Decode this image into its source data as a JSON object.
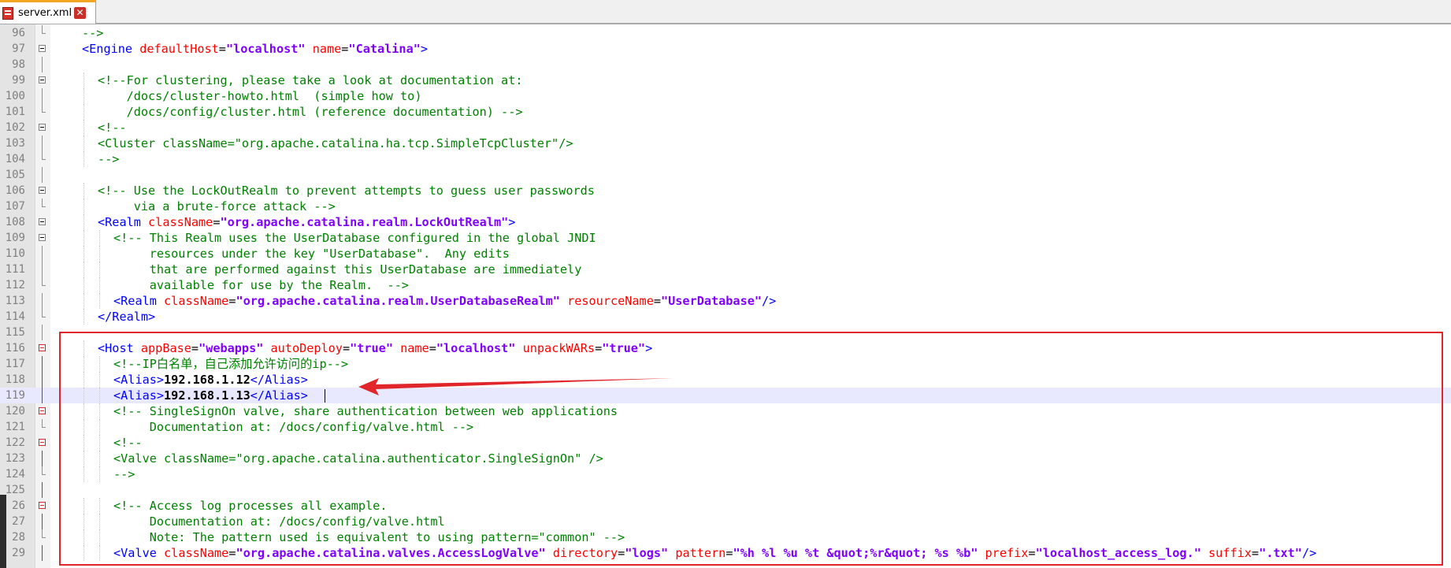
{
  "tab": {
    "filename": "server.xml",
    "close_glyph": "✕"
  },
  "colors": {
    "tag": "#0000ff",
    "attribute": "#ff0000",
    "value": "#8000ff",
    "comment": "#008000",
    "highlight_box": "#e0262a",
    "current_line": "#e8e8ff"
  },
  "lines": [
    {
      "n": "96",
      "fold": "end",
      "seg": [
        [
          "cmt",
          "-->"
        ]
      ]
    },
    {
      "n": "97",
      "fold": "open",
      "indent": 1,
      "seg": [
        [
          "bracket",
          "<"
        ],
        [
          "tag",
          "Engine"
        ],
        [
          "sp",
          " "
        ],
        [
          "attr",
          "defaultHost"
        ],
        [
          "eq",
          "="
        ],
        [
          "val",
          "\"localhost\""
        ],
        [
          "sp",
          " "
        ],
        [
          "attr",
          "name"
        ],
        [
          "eq",
          "="
        ],
        [
          "val",
          "\"Catalina\""
        ],
        [
          "bracket",
          ">"
        ]
      ]
    },
    {
      "n": "98",
      "fold": "line",
      "seg": []
    },
    {
      "n": "99",
      "fold": "open",
      "indent": 2,
      "seg": [
        [
          "cmt",
          "<!--For clustering, please take a look at documentation at:"
        ]
      ]
    },
    {
      "n": "100",
      "fold": "line",
      "indent": 2,
      "seg": [
        [
          "cmt",
          "    /docs/cluster-howto.html  (simple how to)"
        ]
      ]
    },
    {
      "n": "101",
      "fold": "end",
      "indent": 2,
      "seg": [
        [
          "cmt",
          "    /docs/config/cluster.html (reference documentation) -->"
        ]
      ]
    },
    {
      "n": "102",
      "fold": "open",
      "indent": 2,
      "seg": [
        [
          "cmt",
          "<!--"
        ]
      ]
    },
    {
      "n": "103",
      "fold": "line",
      "indent": 2,
      "seg": [
        [
          "cmt",
          "<Cluster className=\"org.apache.catalina.ha.tcp.SimpleTcpCluster\"/>"
        ]
      ]
    },
    {
      "n": "104",
      "fold": "end",
      "indent": 2,
      "seg": [
        [
          "cmt",
          "-->"
        ]
      ]
    },
    {
      "n": "105",
      "fold": "line",
      "seg": []
    },
    {
      "n": "106",
      "fold": "open",
      "indent": 2,
      "seg": [
        [
          "cmt",
          "<!-- Use the LockOutRealm to prevent attempts to guess user passwords"
        ]
      ]
    },
    {
      "n": "107",
      "fold": "end",
      "indent": 2,
      "seg": [
        [
          "cmt",
          "     via a brute-force attack -->"
        ]
      ]
    },
    {
      "n": "108",
      "fold": "open",
      "indent": 2,
      "seg": [
        [
          "bracket",
          "<"
        ],
        [
          "tag",
          "Realm"
        ],
        [
          "sp",
          " "
        ],
        [
          "attr",
          "className"
        ],
        [
          "eq",
          "="
        ],
        [
          "val",
          "\"org.apache.catalina.realm.LockOutRealm\""
        ],
        [
          "bracket",
          ">"
        ]
      ]
    },
    {
      "n": "109",
      "fold": "open",
      "indent": 3,
      "seg": [
        [
          "cmt",
          "<!-- This Realm uses the UserDatabase configured in the global JNDI"
        ]
      ]
    },
    {
      "n": "110",
      "fold": "line",
      "indent": 3,
      "seg": [
        [
          "cmt",
          "     resources under the key \"UserDatabase\".  Any edits"
        ]
      ]
    },
    {
      "n": "111",
      "fold": "line",
      "indent": 3,
      "seg": [
        [
          "cmt",
          "     that are performed against this UserDatabase are immediately"
        ]
      ]
    },
    {
      "n": "112",
      "fold": "end",
      "indent": 3,
      "seg": [
        [
          "cmt",
          "     available for use by the Realm.  -->"
        ]
      ]
    },
    {
      "n": "113",
      "fold": "line",
      "indent": 3,
      "seg": [
        [
          "bracket",
          "<"
        ],
        [
          "tag",
          "Realm"
        ],
        [
          "sp",
          " "
        ],
        [
          "attr",
          "className"
        ],
        [
          "eq",
          "="
        ],
        [
          "val",
          "\"org.apache.catalina.realm.UserDatabaseRealm\""
        ],
        [
          "sp",
          " "
        ],
        [
          "attr",
          "resourceName"
        ],
        [
          "eq",
          "="
        ],
        [
          "val",
          "\"UserDatabase\""
        ],
        [
          "bracket",
          "/>"
        ]
      ]
    },
    {
      "n": "114",
      "fold": "end",
      "indent": 2,
      "seg": [
        [
          "bracket",
          "</"
        ],
        [
          "tag",
          "Realm"
        ],
        [
          "bracket",
          ">"
        ]
      ]
    },
    {
      "n": "115",
      "fold": "line",
      "seg": []
    },
    {
      "n": "116",
      "fold": "open-red",
      "indent": 2,
      "seg": [
        [
          "bracket",
          "<"
        ],
        [
          "tag",
          "Host"
        ],
        [
          "sp",
          " "
        ],
        [
          "attr",
          "appBase"
        ],
        [
          "eq",
          "="
        ],
        [
          "val",
          "\"webapps\""
        ],
        [
          "sp",
          " "
        ],
        [
          "attr",
          "autoDeploy"
        ],
        [
          "eq",
          "="
        ],
        [
          "val",
          "\"true\""
        ],
        [
          "sp",
          " "
        ],
        [
          "attr",
          "name"
        ],
        [
          "eq",
          "="
        ],
        [
          "val",
          "\"localhost\""
        ],
        [
          "sp",
          " "
        ],
        [
          "attr",
          "unpackWARs"
        ],
        [
          "eq",
          "="
        ],
        [
          "val",
          "\"true\""
        ],
        [
          "bracket",
          ">"
        ]
      ]
    },
    {
      "n": "117",
      "fold": "line-red",
      "indent": 3,
      "seg": [
        [
          "cmt",
          "<!--IP白名单，自己添加允许访问的ip-->"
        ]
      ]
    },
    {
      "n": "118",
      "fold": "line-red",
      "indent": 3,
      "seg": [
        [
          "bracket",
          "<"
        ],
        [
          "tag",
          "Alias"
        ],
        [
          "bracket",
          ">"
        ],
        [
          "text",
          "192.168.1.12"
        ],
        [
          "bracket",
          "</"
        ],
        [
          "tag",
          "Alias"
        ],
        [
          "bracket",
          ">"
        ]
      ]
    },
    {
      "n": "119",
      "fold": "line-red",
      "indent": 3,
      "current": true,
      "seg": [
        [
          "bracket",
          "<"
        ],
        [
          "tag",
          "Alias"
        ],
        [
          "bracket",
          ">"
        ],
        [
          "text",
          "192.168.1.13"
        ],
        [
          "bracket",
          "</"
        ],
        [
          "tag",
          "Alias"
        ],
        [
          "bracket",
          ">"
        ]
      ]
    },
    {
      "n": "120",
      "fold": "open-red",
      "indent": 3,
      "seg": [
        [
          "cmt",
          "<!-- SingleSignOn valve, share authentication between web applications"
        ]
      ]
    },
    {
      "n": "121",
      "fold": "end-red",
      "indent": 3,
      "seg": [
        [
          "cmt",
          "     Documentation at: /docs/config/valve.html -->"
        ]
      ]
    },
    {
      "n": "122",
      "fold": "open-red",
      "indent": 3,
      "seg": [
        [
          "cmt",
          "<!--"
        ]
      ]
    },
    {
      "n": "123",
      "fold": "line-red",
      "indent": 3,
      "seg": [
        [
          "cmt",
          "<Valve className=\"org.apache.catalina.authenticator.SingleSignOn\" />"
        ]
      ]
    },
    {
      "n": "124",
      "fold": "end-red",
      "indent": 3,
      "seg": [
        [
          "cmt",
          "-->"
        ]
      ]
    },
    {
      "n": "125",
      "fold": "line-red",
      "seg": []
    },
    {
      "n": "26",
      "fold": "open-red",
      "indent": 3,
      "seg": [
        [
          "cmt",
          "<!-- Access log processes all example."
        ]
      ]
    },
    {
      "n": "27",
      "fold": "line-red",
      "indent": 3,
      "seg": [
        [
          "cmt",
          "     Documentation at: /docs/config/valve.html"
        ]
      ]
    },
    {
      "n": "28",
      "fold": "end-red",
      "indent": 3,
      "seg": [
        [
          "cmt",
          "     Note: The pattern used is equivalent to using pattern=\"common\" -->"
        ]
      ]
    },
    {
      "n": "29",
      "fold": "line-red",
      "indent": 3,
      "seg": [
        [
          "bracket",
          "<"
        ],
        [
          "tag",
          "Valve"
        ],
        [
          "sp",
          " "
        ],
        [
          "attr",
          "className"
        ],
        [
          "eq",
          "="
        ],
        [
          "val",
          "\"org.apache.catalina.valves.AccessLogValve\""
        ],
        [
          "sp",
          " "
        ],
        [
          "attr",
          "directory"
        ],
        [
          "eq",
          "="
        ],
        [
          "val",
          "\"logs\""
        ],
        [
          "sp",
          " "
        ],
        [
          "attr",
          "pattern"
        ],
        [
          "eq",
          "="
        ],
        [
          "val",
          "\"%h %l %u %t &quot;%r&quot; %s %b\""
        ],
        [
          "sp",
          " "
        ],
        [
          "attr",
          "prefix"
        ],
        [
          "eq",
          "="
        ],
        [
          "val",
          "\"localhost_access_log.\""
        ],
        [
          "sp",
          " "
        ],
        [
          "attr",
          "suffix"
        ],
        [
          "eq",
          "="
        ],
        [
          "val",
          "\".txt\""
        ],
        [
          "bracket",
          "/>"
        ]
      ]
    }
  ]
}
